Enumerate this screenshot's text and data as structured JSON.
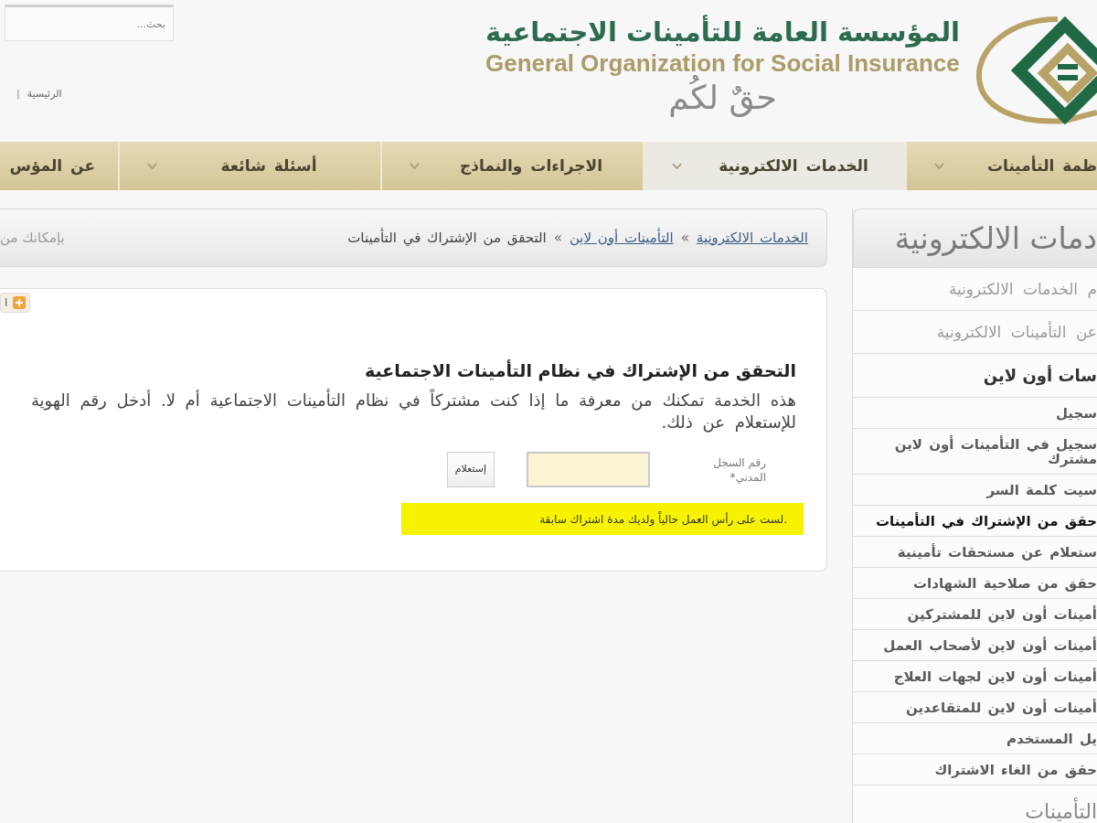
{
  "header": {
    "search": {
      "placeholder": "بحث..."
    },
    "links": [
      {
        "kind": "link",
        "label": "الرئيسية"
      },
      {
        "kind": "separator",
        "label": "|"
      }
    ],
    "org_name_ar": "المؤسسة العامة للتأمينات الاجتماعية",
    "org_name_en": "General Organization for Social Insurance",
    "slogan": "حقٌ لكُم"
  },
  "nav": [
    {
      "label": "ظمة التأمينات",
      "selected": false,
      "caret": true
    },
    {
      "label": "الخدمات الالكترونية",
      "selected": true,
      "caret": true
    },
    {
      "label": "الاجراءات والنماذج",
      "selected": false,
      "caret": true
    },
    {
      "label": "أسئلة شائعة",
      "selected": false,
      "caret": true
    },
    {
      "label": "عن المؤس",
      "selected": false,
      "caret": false
    }
  ],
  "breadcrumb": {
    "items": [
      {
        "kind": "link",
        "label": "الخدمات الالكترونية"
      },
      {
        "kind": "separator",
        "label": "»"
      },
      {
        "kind": "link",
        "label": "التأمينات أون لاين"
      },
      {
        "kind": "separator",
        "label": "»"
      },
      {
        "kind": "current",
        "label": "التحقق من الإشتراك في التأمينات"
      }
    ],
    "note": "بإمكانك من"
  },
  "content": {
    "tool_button": "ا",
    "title": "التحقق من الإشتراك في نظام التأمينات الاجتماعية",
    "description": "هذه الخدمة تمكنك من معرفة ما إذا كنت مشتركاً في نظام التأمينات الاجتماعية أم لا. أدخل رقم الهوية\nللإستعلام عن ذلك.",
    "form": {
      "label": "رقم السجل\nالمدني*",
      "button": "إستعلام"
    },
    "result": "لست على رأس العمل حالياً ولديك مدة اشتراك سابقة."
  },
  "sidebar": {
    "title": "دمات الالكترونية",
    "items": [
      {
        "kind": "link",
        "label": "م الخدمات الالكترونية",
        "selected": false
      },
      {
        "kind": "link",
        "label": "عن التأمينات الالكترونية",
        "selected": false
      },
      {
        "kind": "section",
        "label": "سات أون لاين",
        "selected": false,
        "children": [
          {
            "label": "سجيل",
            "selected": false
          },
          {
            "label": "سجيل في التأمينات أون لاين\nمشترك",
            "selected": false
          },
          {
            "label": "سيت كلمة السر",
            "selected": false
          },
          {
            "label": "حقق من الإشتراك في التأمينات",
            "selected": true
          },
          {
            "label": "ستعلام عن مستحقات تأمينية",
            "selected": false
          },
          {
            "label": "حقق من صلاحية الشهادات",
            "selected": false
          },
          {
            "label": "أمينات أون لاين للمشتركين",
            "selected": false
          },
          {
            "label": "أمينات أون لاين لأصحاب العمل",
            "selected": false
          },
          {
            "label": "أمينات أون لاين لجهات العلاج",
            "selected": false
          },
          {
            "label": "أمينات أون لاين للمتقاعدين",
            "selected": false
          },
          {
            "label": "يل المستخدم",
            "selected": false
          },
          {
            "label": "حقق من الغاء الاشتراك",
            "selected": false
          }
        ]
      },
      {
        "kind": "heading",
        "label": "التأمينات",
        "selected": false
      }
    ]
  }
}
